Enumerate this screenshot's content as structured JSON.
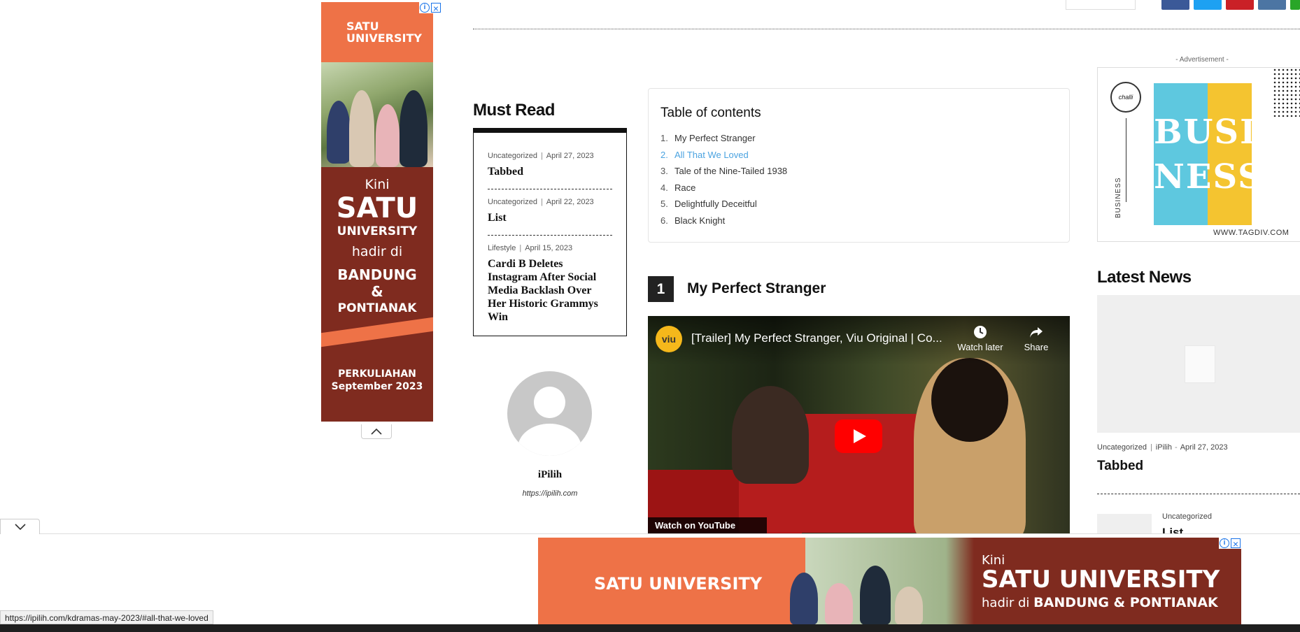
{
  "left_ad": {
    "brand": "SATU UNIVERSITY",
    "kini": "Kini",
    "satu": "SATU",
    "university": "UNIVERSITY",
    "hadir": "hadir di",
    "bandung": "BANDUNG",
    "amp": "&",
    "pontianak": "PONTIANAK",
    "perkuliahan": "PERKULIAHAN",
    "september": "September 2023"
  },
  "must_read": {
    "title": "Must Read",
    "items": [
      {
        "category": "Uncategorized",
        "date": "April 27, 2023",
        "title": "Tabbed"
      },
      {
        "category": "Uncategorized",
        "date": "April 22, 2023",
        "title": "List"
      },
      {
        "category": "Lifestyle",
        "date": "April 15, 2023",
        "title": "Cardi B Deletes Instagram After Social Media Backlash Over Her Historic Grammys Win"
      }
    ]
  },
  "author": {
    "name": "iPilih",
    "url": "https://ipilih.com"
  },
  "toc": {
    "title": "Table of contents",
    "items": [
      {
        "num": "1.",
        "label": "My Perfect Stranger"
      },
      {
        "num": "2.",
        "label": "All That We Loved"
      },
      {
        "num": "3.",
        "label": "Tale of the Nine-Tailed 1938"
      },
      {
        "num": "4.",
        "label": "Race"
      },
      {
        "num": "5.",
        "label": "Delightfully Deceitful"
      },
      {
        "num": "6.",
        "label": "Black Knight"
      }
    ],
    "active_index": 1,
    "active_color": "#4ba3e0"
  },
  "section": {
    "number": "1",
    "title": "My Perfect Stranger"
  },
  "video": {
    "channel_logo": "viu",
    "title": "[Trailer] My Perfect Stranger, Viu Original | Co...",
    "watch_later": "Watch later",
    "share": "Share",
    "watch_on": "Watch on YouTube"
  },
  "right_column": {
    "advertisement_label": "- Advertisement -",
    "ad_big_text": "BUSI NESS",
    "ad_badge": "challi",
    "ad_vertical_label": "BUSINESS",
    "ad_url": "WWW.TAGDIV.COM",
    "latest_news_title": "Latest News",
    "latest_items": [
      {
        "category": "Uncategorized",
        "author": "iPilih",
        "date": "April 27, 2023",
        "title": "Tabbed"
      },
      {
        "category": "Uncategorized",
        "title": "List"
      }
    ]
  },
  "bottom_ad": {
    "brand": "SATU UNIVERSITY",
    "kini": "Kini",
    "big": "SATU UNIVERSITY",
    "hadir": "hadir di",
    "cities": "BANDUNG & PONTIANAK"
  },
  "status_url": "https://ipilih.com/kdramas-may-2023/#all-that-we-loved",
  "colors": {
    "ad_orange": "#ee7247",
    "ad_maroon": "#7f2b1f",
    "link_active": "#4ba3e0",
    "youtube_red": "#ff0000"
  }
}
